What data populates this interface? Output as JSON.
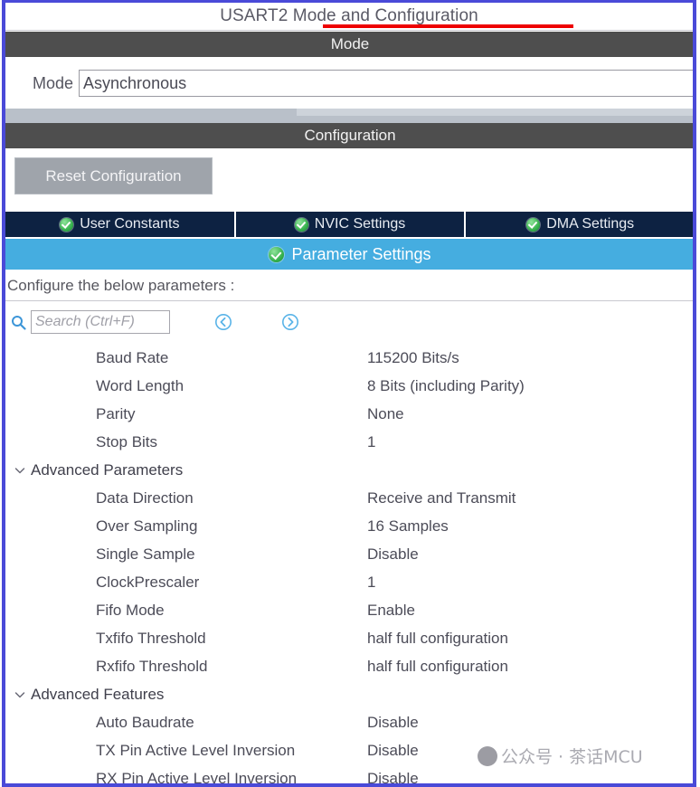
{
  "window": {
    "title": "USART2 Mode and Configuration",
    "title_underline_color": "#ee0000"
  },
  "mode_section": {
    "header": "Mode",
    "mode_label": "Mode",
    "mode_value": "Asynchronous"
  },
  "configuration_section": {
    "header": "Configuration",
    "reset_button": "Reset Configuration"
  },
  "tabs": {
    "items": [
      {
        "label": "User Constants",
        "icon": "green-check-icon",
        "active": false
      },
      {
        "label": "NVIC Settings",
        "icon": "green-check-icon",
        "active": false
      },
      {
        "label": "DMA Settings",
        "icon": "green-check-icon",
        "active": false
      }
    ],
    "active_tab": {
      "label": "Parameter Settings",
      "icon": "green-check-icon",
      "active": true
    },
    "inactive_color": "#0d2242",
    "active_color": "#45ade0"
  },
  "parameters_panel": {
    "hint": "Configure the below parameters :",
    "search": {
      "placeholder": "Search (Ctrl+F)",
      "value": "",
      "icon": "search-icon"
    },
    "nav_prev_icon": "chevron-left-circle-icon",
    "nav_next_icon": "chevron-right-circle-icon",
    "rows": [
      {
        "kind": "param",
        "name": "Baud Rate",
        "value": "115200 Bits/s"
      },
      {
        "kind": "param",
        "name": "Word Length",
        "value": "8 Bits (including Parity)"
      },
      {
        "kind": "param",
        "name": "Parity",
        "value": "None"
      },
      {
        "kind": "param",
        "name": "Stop Bits",
        "value": "1"
      },
      {
        "kind": "group",
        "name": "Advanced Parameters",
        "expanded": true
      },
      {
        "kind": "param",
        "name": "Data Direction",
        "value": "Receive and Transmit"
      },
      {
        "kind": "param",
        "name": "Over Sampling",
        "value": "16 Samples"
      },
      {
        "kind": "param",
        "name": "Single Sample",
        "value": "Disable"
      },
      {
        "kind": "param",
        "name": "ClockPrescaler",
        "value": "1"
      },
      {
        "kind": "param",
        "name": "Fifo Mode",
        "value": "Enable"
      },
      {
        "kind": "param",
        "name": "Txfifo Threshold",
        "value": "half full configuration"
      },
      {
        "kind": "param",
        "name": "Rxfifo Threshold",
        "value": "half full configuration"
      },
      {
        "kind": "group",
        "name": "Advanced Features",
        "expanded": true
      },
      {
        "kind": "param",
        "name": "Auto Baudrate",
        "value": "Disable"
      },
      {
        "kind": "param",
        "name": "TX Pin Active Level Inversion",
        "value": "Disable"
      },
      {
        "kind": "param",
        "name": "RX Pin Active Level Inversion",
        "value": "Disable"
      }
    ]
  },
  "watermark": {
    "text": "公众号 · 茶话MCU"
  }
}
